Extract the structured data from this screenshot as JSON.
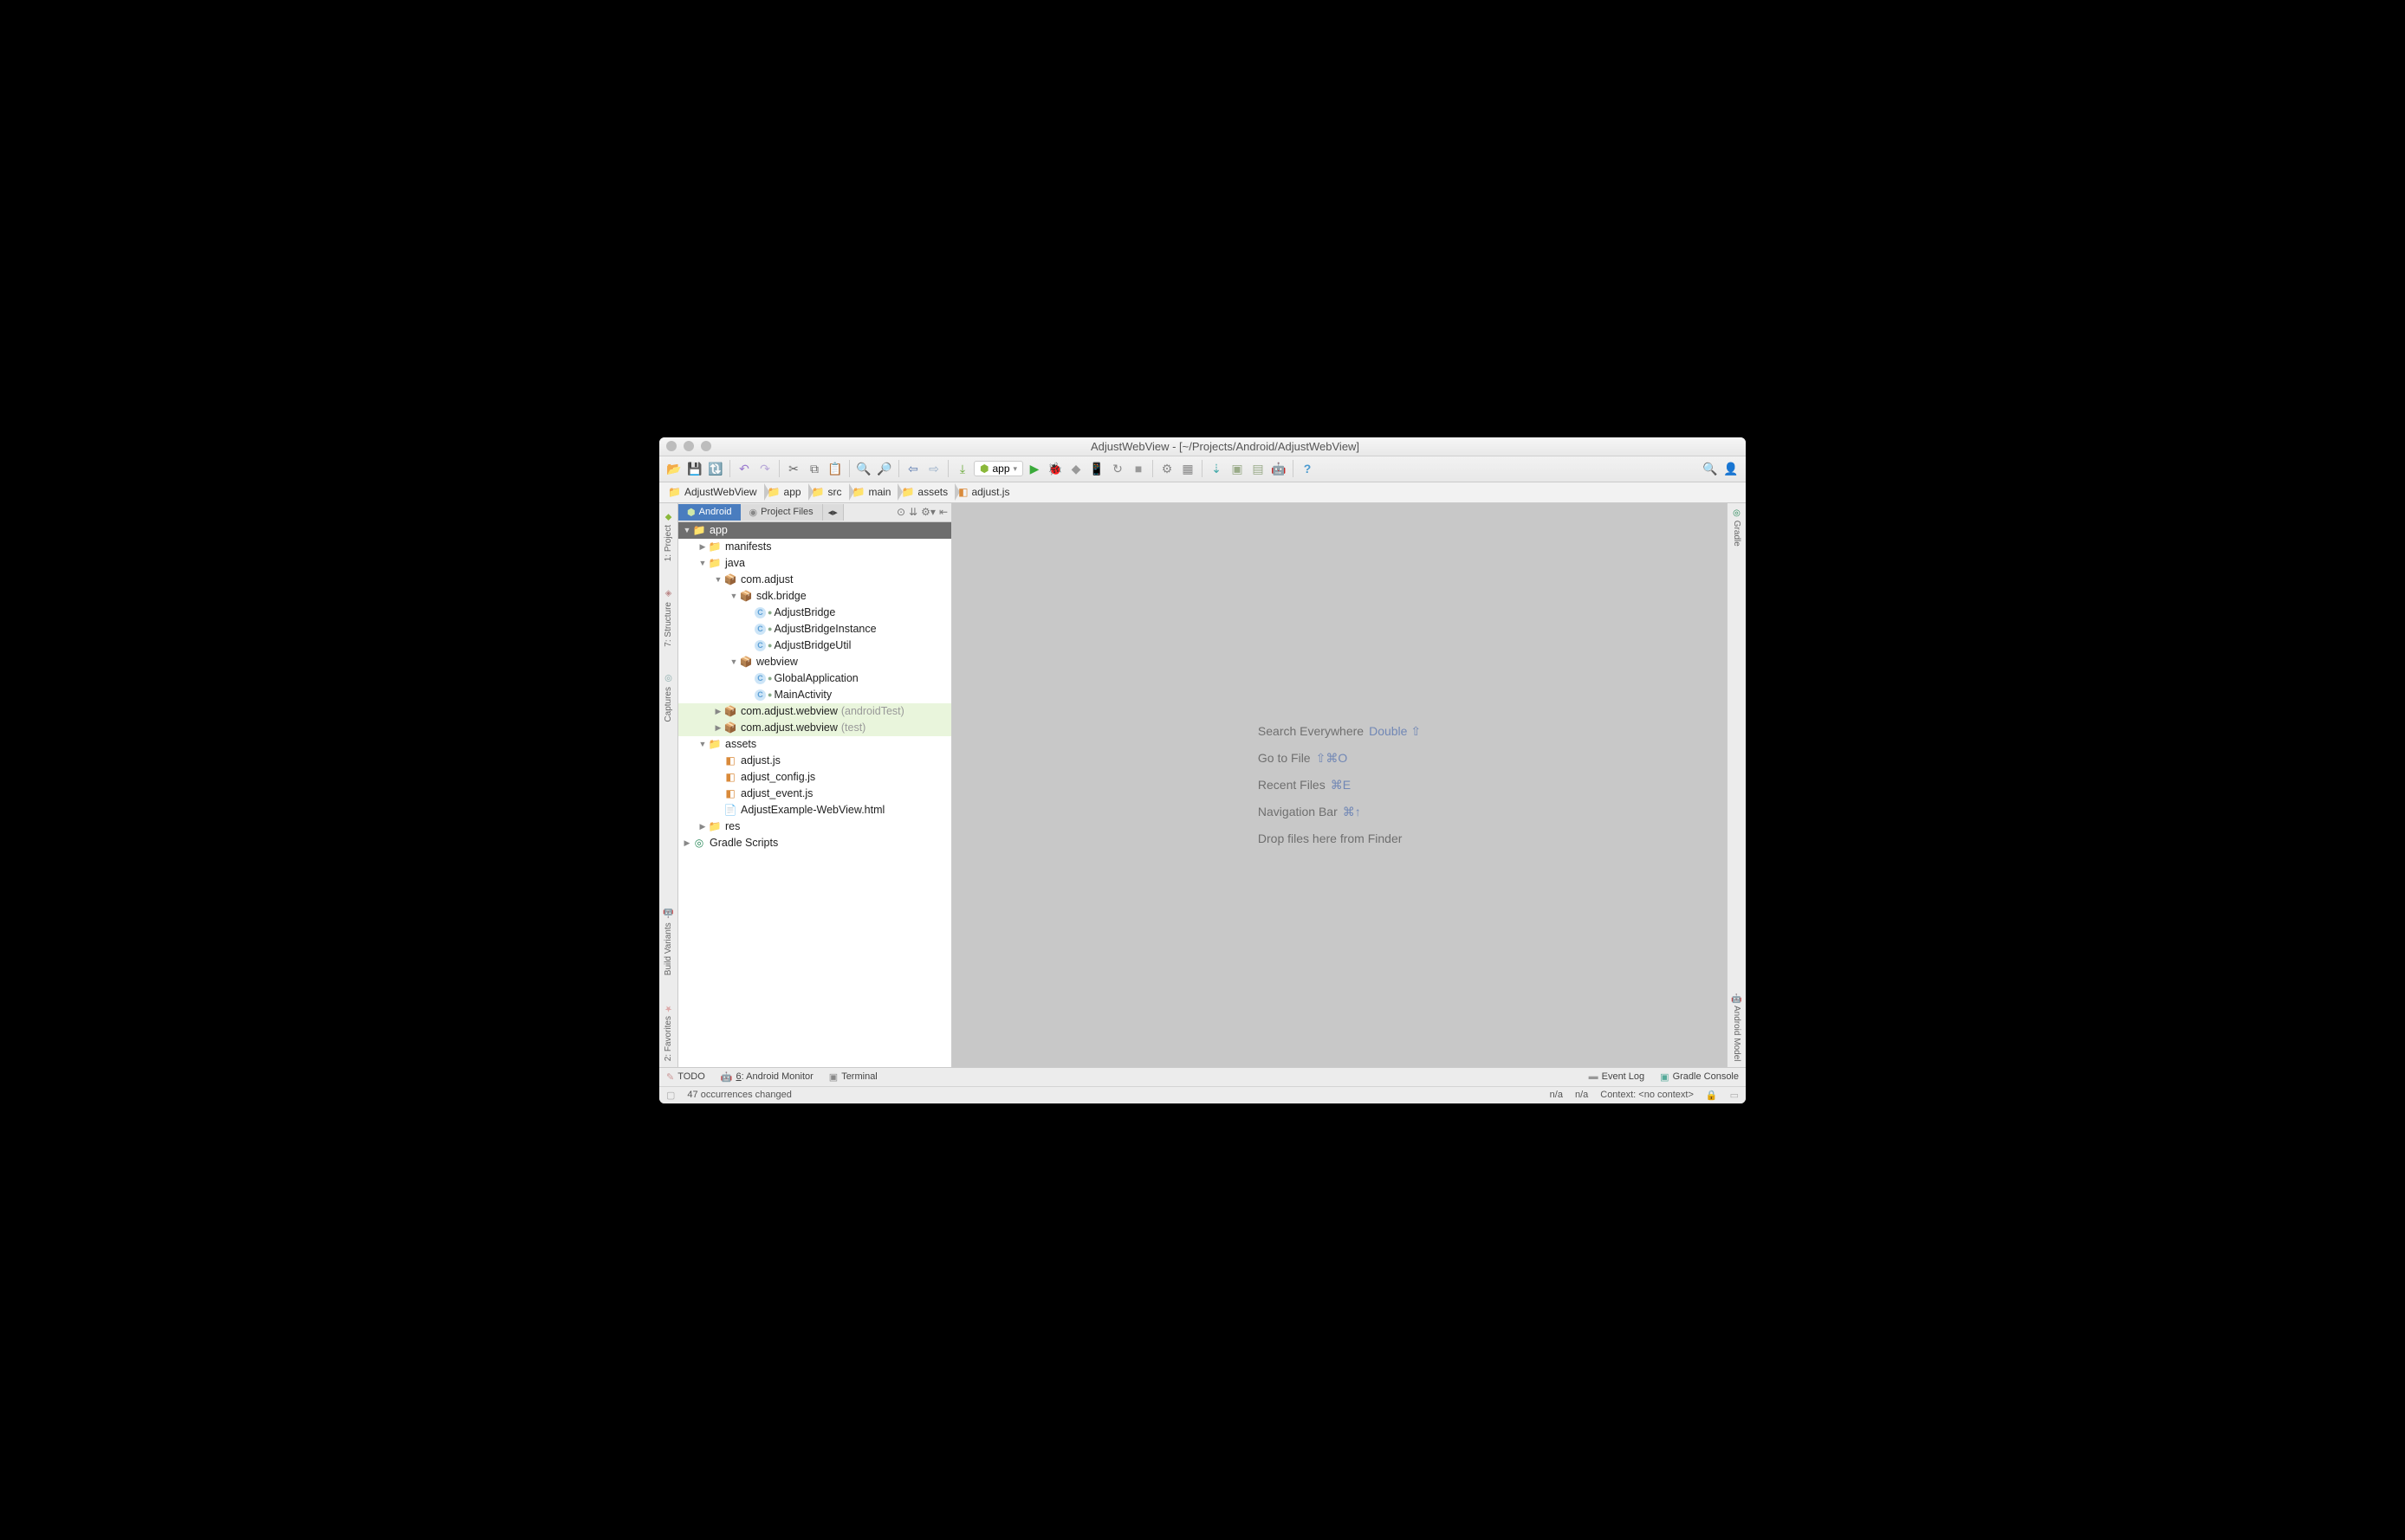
{
  "window": {
    "title": "AdjustWebView - [~/Projects/Android/AdjustWebView]"
  },
  "runconfig": {
    "label": "app"
  },
  "breadcrumbs": [
    {
      "label": "AdjustWebView"
    },
    {
      "label": "app"
    },
    {
      "label": "src"
    },
    {
      "label": "main"
    },
    {
      "label": "assets"
    },
    {
      "label": "adjust.js"
    }
  ],
  "panel": {
    "tabs": {
      "android": "Android",
      "project_files": "Project Files"
    }
  },
  "tree": {
    "app": "app",
    "manifests": "manifests",
    "java": "java",
    "pkg_comadjust": "com.adjust",
    "pkg_sdkbridge": "sdk.bridge",
    "cls_AdjustBridge": "AdjustBridge",
    "cls_AdjustBridgeInstance": "AdjustBridgeInstance",
    "cls_AdjustBridgeUtil": "AdjustBridgeUtil",
    "pkg_webview": "webview",
    "cls_GlobalApplication": "GlobalApplication",
    "cls_MainActivity": "MainActivity",
    "pkg_at": "com.adjust.webview",
    "hint_at": "(androidTest)",
    "pkg_test": "com.adjust.webview",
    "hint_test": "(test)",
    "assets": "assets",
    "f_adjust": "adjust.js",
    "f_adjust_config": "adjust_config.js",
    "f_adjust_event": "adjust_event.js",
    "f_example_html": "AdjustExample-WebView.html",
    "res": "res",
    "gradle": "Gradle Scripts"
  },
  "hints": {
    "search_label": "Search Everywhere",
    "search_key": "Double ⇧",
    "goto_label": "Go to File",
    "goto_key": "⇧⌘O",
    "recent_label": "Recent Files",
    "recent_key": "⌘E",
    "nav_label": "Navigation Bar",
    "nav_key": "⌘↑",
    "drop_label": "Drop files here from Finder"
  },
  "left_gutter": {
    "project": "1: Project",
    "structure": "7: Structure",
    "captures": "Captures",
    "build_variants": "Build Variants",
    "favorites": "2: Favorites"
  },
  "right_gutter": {
    "gradle": "Gradle",
    "android_model": "Android Model"
  },
  "bottom": {
    "todo": "TODO",
    "android_monitor": "6: Android Monitor",
    "terminal": "Terminal",
    "event_log": "Event Log",
    "gradle_console": "Gradle Console"
  },
  "status": {
    "message": "47 occurrences changed",
    "na1": "n/a",
    "na2": "n/a",
    "context": "Context: <no context>"
  }
}
